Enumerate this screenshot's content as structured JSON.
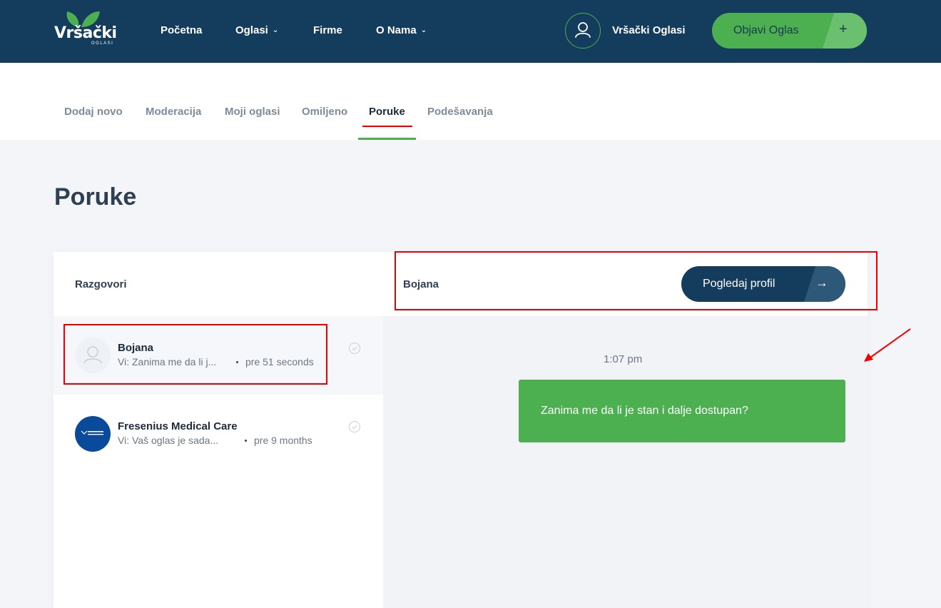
{
  "brand": {
    "name": "Vršački",
    "sub": "OGLASI"
  },
  "nav": [
    {
      "label": "Početna",
      "has_menu": false
    },
    {
      "label": "Oglasi",
      "has_menu": true
    },
    {
      "label": "Firme",
      "has_menu": false
    },
    {
      "label": "O Nama",
      "has_menu": true
    }
  ],
  "user": {
    "name": "Vršački Oglasi",
    "icon": "user-icon"
  },
  "post_button": {
    "label": "Objavi Oglas",
    "icon": "+"
  },
  "tabs": [
    {
      "label": "Dodaj novo"
    },
    {
      "label": "Moderacija"
    },
    {
      "label": "Moji oglasi"
    },
    {
      "label": "Omiljeno"
    },
    {
      "label": "Poruke",
      "active": true
    },
    {
      "label": "Podešavanja"
    }
  ],
  "page_title": "Poruke",
  "conversations_header": "Razgovori",
  "conversations": [
    {
      "name": "Bojana",
      "preview": "Vi: Zanima me da li j...",
      "time": "pre 51 seconds",
      "selected": true
    },
    {
      "name": "Fresenius Medical Care",
      "preview": "Vi: Vaš oglas je sada...",
      "time": "pre 9 months",
      "selected": false
    }
  ],
  "chat": {
    "contact_name": "Bojana",
    "profile_button": "Pogledaj profil",
    "profile_arrow": "→",
    "messages": [
      {
        "time": "1:07 pm",
        "text": "Zanima me da li je stan i dalje dostupan?",
        "outgoing": true
      }
    ]
  },
  "colors": {
    "header": "#143c5c",
    "accent": "#4caf50",
    "annotation": "#e00000"
  }
}
